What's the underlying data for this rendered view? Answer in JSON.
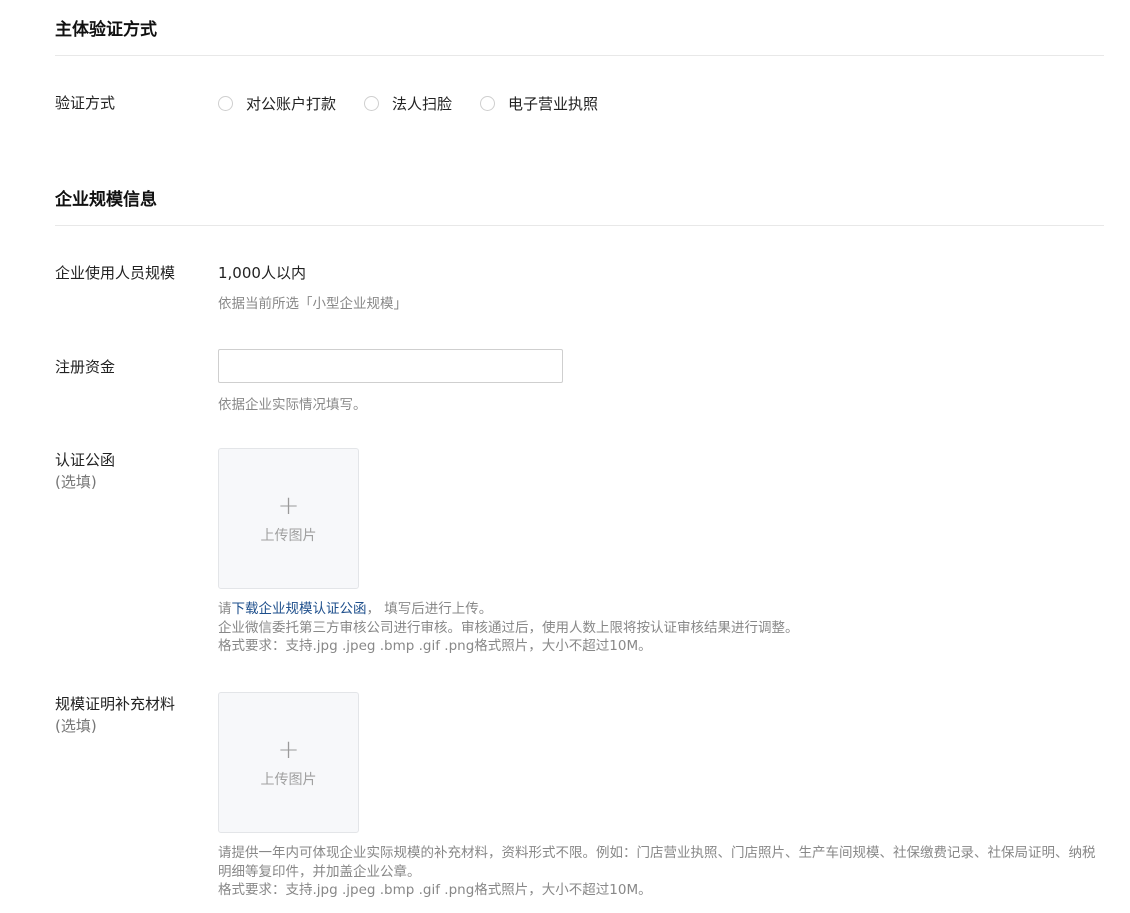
{
  "verify_section": {
    "title": "主体验证方式",
    "method_label": "验证方式",
    "options": [
      "对公账户打款",
      "法人扫脸",
      "电子营业执照"
    ]
  },
  "scale_section": {
    "title": "企业规模信息",
    "staff": {
      "label": "企业使用人员规模",
      "value": "1,000人以内",
      "hint": "依据当前所选「小型企业规模」"
    },
    "capital": {
      "label": "注册资金",
      "value": "",
      "placeholder": "",
      "hint": "依据企业实际情况填写。"
    },
    "letter": {
      "label": "认证公函",
      "optional": "(选填)",
      "upload_text": "上传图片",
      "hint_prefix": "请",
      "hint_link": "下载企业规模认证公函",
      "hint_suffix": "， 填写后进行上传。",
      "hint_line2": "企业微信委托第三方审核公司进行审核。审核通过后，使用人数上限将按认证审核结果进行调整。",
      "hint_line3": "格式要求：支持.jpg .jpeg .bmp .gif .png格式照片，大小不超过10M。"
    },
    "supplement": {
      "label": "规模证明补充材料",
      "optional": "(选填)",
      "upload_text": "上传图片",
      "hint_line1": "请提供一年内可体现企业实际规模的补充材料，资料形式不限。例如：门店营业执照、门店照片、生产车间规模、社保缴费记录、社保局证明、纳税明细等复印件，并加盖企业公章。",
      "hint_line2": "格式要求：支持.jpg .jpeg .bmp .gif .png格式照片，大小不超过10M。"
    }
  },
  "icons": {
    "upload": "plus-icon",
    "radio": "radio-unchecked-icon"
  },
  "colors": {
    "link": "#1e4f8c",
    "hint": "#888888",
    "divider": "#e8e8e8",
    "upload_bg": "#f7f8fa"
  }
}
